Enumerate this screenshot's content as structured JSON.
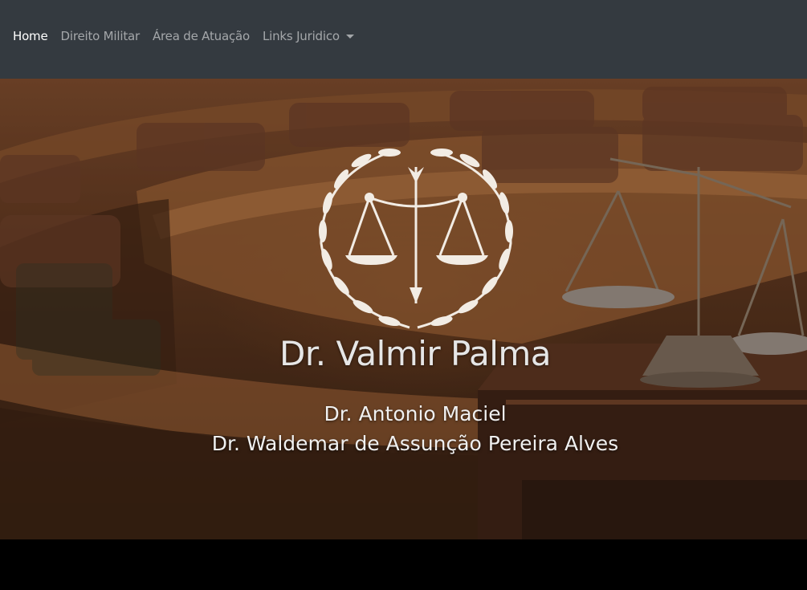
{
  "nav": {
    "items": [
      {
        "label": "Home"
      },
      {
        "label": "Direito Militar"
      },
      {
        "label": "Área de Atuação"
      },
      {
        "label": "Links Juridico"
      }
    ],
    "dropdown_icon": "caret-down-icon"
  },
  "hero": {
    "emblem_icon": "scales-of-justice-laurel-icon",
    "title": "Dr. Valmir Palma",
    "subtitles": [
      "Dr. Antonio Maciel",
      "Dr. Waldemar de Assunção Pereira Alves"
    ],
    "background_image": "courtroom-with-scales-photo"
  },
  "colors": {
    "navbar_bg": "#343a40",
    "nav_active": "#ffffff",
    "nav_inactive": "rgba(255,255,255,0.55)",
    "footer_bg": "#000000"
  }
}
